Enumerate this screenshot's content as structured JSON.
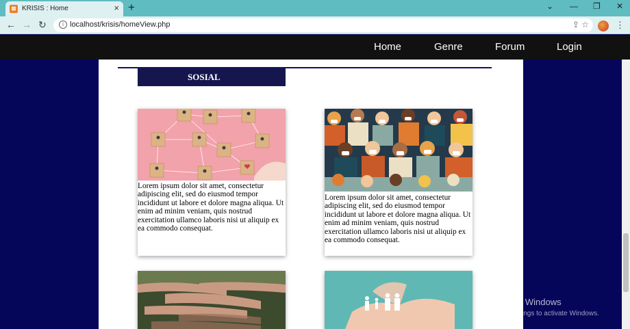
{
  "browser": {
    "tab_title": "KRISIS : Home",
    "tab_favicon": "xampp-icon",
    "new_tab": "+",
    "url": "localhost/krisis/homeView.php"
  },
  "site_nav": {
    "items": [
      {
        "label": "Home"
      },
      {
        "label": "Genre"
      },
      {
        "label": "Forum"
      },
      {
        "label": "Login"
      }
    ]
  },
  "section": {
    "label": "SOSIAL"
  },
  "cards": [
    {
      "text": "Lorem ipsum dolor sit amet, consectetur adipiscing elit, sed do eiusmod tempor incididunt ut labore et dolore magna aliqua. Ut enim ad minim veniam, quis nostrud exercitation ullamco laboris nisi ut aliquip ex ea commodo consequat.",
      "image": "network-cubes-image"
    },
    {
      "text": "Lorem ipsum dolor sit amet, consectetur adipiscing elit, sed do eiusmod tempor incididunt ut labore et dolore magna aliqua. Ut enim ad minim veniam, quis nostrud exercitation ullamco laboris nisi ut aliquip ex ea commodo consequat.",
      "image": "crowd-masks-image"
    },
    {
      "text": "",
      "image": "stacked-hands-image"
    },
    {
      "text": "",
      "image": "family-hands-image"
    }
  ],
  "watermark": {
    "title": "Activate Windows",
    "subtitle": "Go to Settings to activate Windows."
  },
  "colors": {
    "page_bg": "#05065a",
    "nav_bg": "#111111",
    "section_tag_bg": "#16164e",
    "tab_bar": "#5fbcc1"
  }
}
